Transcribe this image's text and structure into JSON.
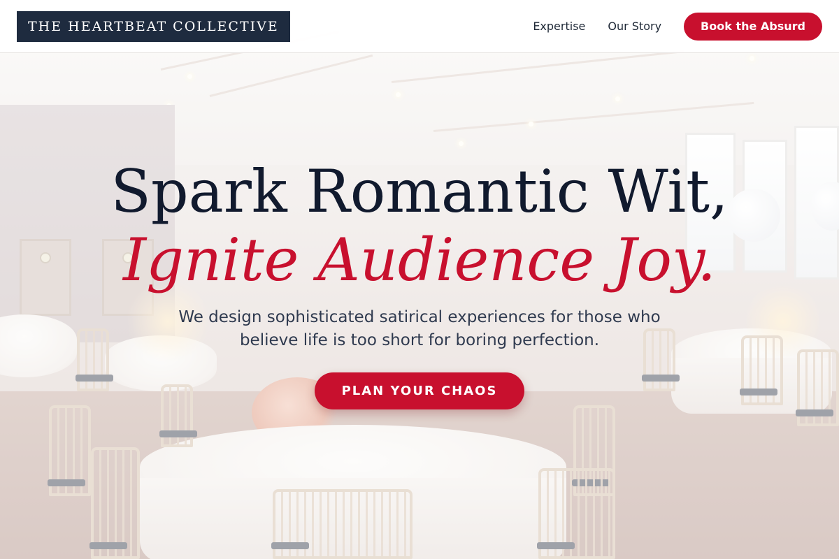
{
  "header": {
    "brand": "THE HEARTBEAT COLLECTIVE",
    "nav": [
      {
        "label": "Expertise"
      },
      {
        "label": "Our Story"
      }
    ],
    "cta_label": "Book the Absurd"
  },
  "hero": {
    "headline_line1": "Spark Romantic Wit,",
    "headline_line2": "Ignite Audience Joy.",
    "subtitle": "We design sophisticated satirical experiences for those who believe life is too short for boring perfection.",
    "cta_label": "PLAN YOUR CHAOS"
  },
  "colors": {
    "brand_navy": "#1e2b3f",
    "accent_red": "#c8102e",
    "headline_dark": "#111a2e"
  }
}
